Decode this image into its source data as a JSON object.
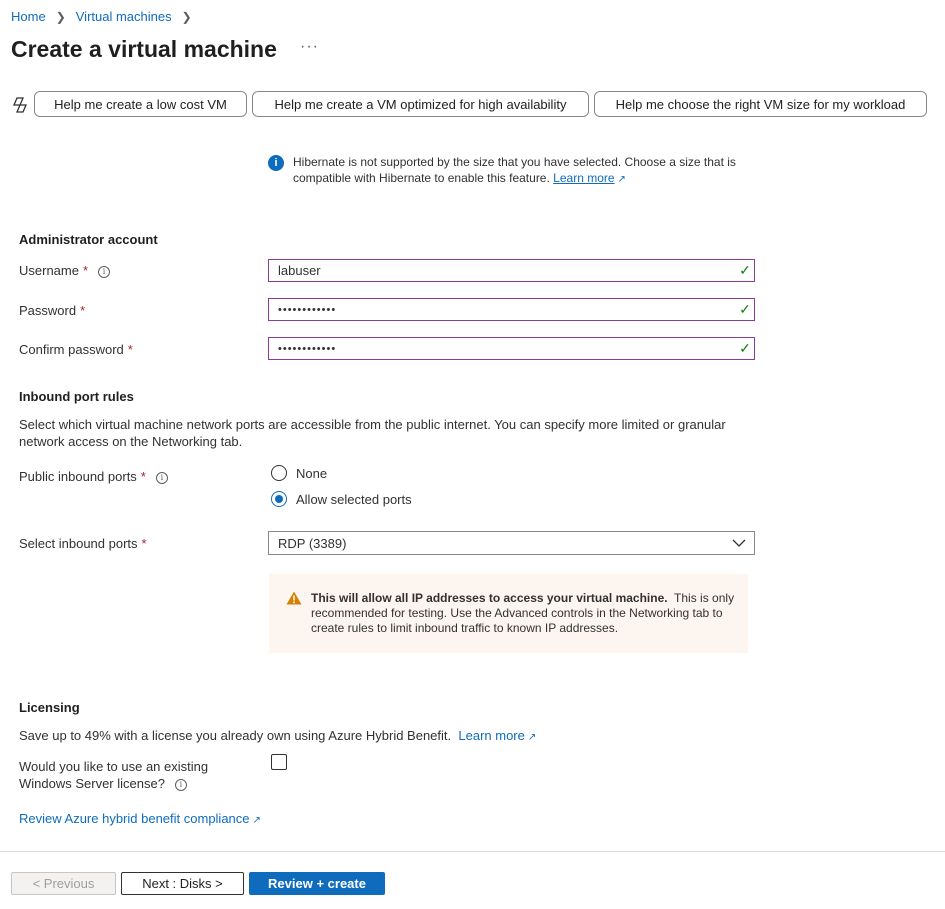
{
  "breadcrumb": {
    "items": [
      "Home",
      "Virtual machines"
    ]
  },
  "page": {
    "title": "Create a virtual machine",
    "more": "···"
  },
  "copilot": {
    "icon": "copilot-icon",
    "suggestions": [
      "Help me create a low cost VM",
      "Help me create a VM optimized for high availability",
      "Help me choose the right VM size for my workload"
    ]
  },
  "hibernate_info": {
    "icon": "info-icon",
    "text": "Hibernate is not supported by the size that you have selected. Choose a size that is compatible with Hibernate to enable this feature.",
    "link": "Learn more"
  },
  "admin": {
    "heading": "Administrator account",
    "username_label": "Username",
    "username_value": "labuser",
    "password_label": "Password",
    "password_value": "••••••••••••",
    "confirm_label": "Confirm password",
    "confirm_value": "••••••••••••",
    "required_mark": "*"
  },
  "inbound": {
    "heading": "Inbound port rules",
    "description": "Select which virtual machine network ports are accessible from the public internet. You can specify more limited or granular network access on the Networking tab.",
    "public_ports_label": "Public inbound ports",
    "options": [
      "None",
      "Allow selected ports"
    ],
    "selected_option": "Allow selected ports",
    "select_ports_label": "Select inbound ports",
    "select_ports_value": "RDP (3389)",
    "warning_bold": "This will allow all IP addresses to access your virtual machine.",
    "warning_text": "This is only recommended for testing.  Use the Advanced controls in the Networking tab to create rules to limit inbound traffic to known IP addresses."
  },
  "licensing": {
    "heading": "Licensing",
    "description": "Save up to 49% with a license you already own using Azure Hybrid Benefit.",
    "learn_more": "Learn more",
    "question_line1": "Would you like to use an existing",
    "question_line2": "Windows Server license?",
    "compliance_link": "Review Azure hybrid benefit compliance"
  },
  "footer": {
    "previous": "< Previous",
    "next": "Next : Disks >",
    "review": "Review + create"
  },
  "colors": {
    "accent": "#0f6cbd",
    "valid_border": "#8a3a9a",
    "success": "#107c10",
    "warning": "#d67f00",
    "required": "#a4262c"
  }
}
